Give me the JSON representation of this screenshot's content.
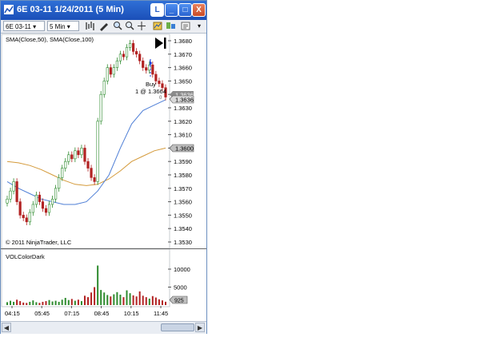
{
  "window": {
    "title": "6E 03-11  1/24/2011 (5 Min)",
    "btn_l": "L",
    "btn_min": "_",
    "btn_max": "□",
    "btn_close": "X"
  },
  "toolbar": {
    "instrument": "6E 03-11",
    "interval": "5 Min",
    "dropdown_glyph": "▾"
  },
  "price_panel": {
    "indicator_label": "SMA(Close,50), SMA(Close,100)",
    "copyright": "© 2011 NinjaTrader, LLC",
    "price_badge": "1.3636",
    "price_badge_top": "1.3636",
    "sma_badge": "1.3600",
    "order_text_1": "Buy",
    "order_text_2": "1 @ 1.3664",
    "order_small": "0"
  },
  "volume_panel": {
    "label": "VOLColorDark",
    "volume_badge": "925"
  },
  "colors": {
    "up": "#2e8b2e",
    "down": "#b22222",
    "sma50": "#4f7fd6",
    "sma100": "#d49a3a",
    "titlebar": "#2f6fd6"
  },
  "chart_data": [
    {
      "type": "line",
      "title": "",
      "x": [
        "04:15",
        "05:45",
        "07:15",
        "08:45",
        "10:15",
        "11:45"
      ],
      "ylim": [
        1.353,
        1.368
      ],
      "yticks": [
        "1.3680",
        "1.3670",
        "1.3660",
        "1.3650",
        "1.3640",
        "1.3630",
        "1.3620",
        "1.3610",
        "1.3600",
        "1.3590",
        "1.3580",
        "1.3570",
        "1.3560",
        "1.3550",
        "1.3540",
        "1.3530"
      ],
      "series": [
        {
          "values": [
            1.3562,
            1.3568,
            1.3575,
            1.356,
            1.355,
            1.3548,
            1.3545,
            1.3552,
            1.3558,
            1.3565,
            1.356,
            1.3555,
            1.3552,
            1.3558,
            1.3562,
            1.357,
            1.3578,
            1.3585,
            1.359,
            1.3595,
            1.3592,
            1.3598,
            1.3595,
            1.36,
            1.359,
            1.3585,
            1.3578,
            1.3575,
            1.362,
            1.364,
            1.365,
            1.366,
            1.3655,
            1.366,
            1.3665,
            1.367,
            1.3668,
            1.3675,
            1.3678,
            1.3672,
            1.367,
            1.3665,
            1.366,
            1.3658,
            1.3662,
            1.3655,
            1.365,
            1.3648,
            1.3645,
            1.3638
          ]
        },
        {
          "values": [
            1.3575,
            1.357,
            1.3566,
            1.3562,
            1.356,
            1.3558,
            1.3558,
            1.356,
            1.3568,
            1.358,
            1.36,
            1.3618,
            1.3628,
            1.3632,
            1.3636
          ]
        },
        {
          "values": [
            1.359,
            1.3589,
            1.3587,
            1.3584,
            1.358,
            1.3576,
            1.3573,
            1.3572,
            1.3573,
            1.3577,
            1.3583,
            1.359,
            1.3594,
            1.3598,
            1.36
          ]
        }
      ]
    },
    {
      "type": "bar",
      "title": "",
      "yticks": [
        "10000",
        "5000"
      ],
      "ylim": [
        0,
        12000
      ],
      "values": [
        800,
        1200,
        900,
        1500,
        1100,
        700,
        600,
        900,
        1300,
        800,
        600,
        900,
        1100,
        1400,
        1000,
        1200,
        900,
        1500,
        2000,
        1400,
        1700,
        1200,
        1500,
        1100,
        2600,
        2200,
        3500,
        5000,
        11000,
        4200,
        3500,
        2800,
        2400,
        3000,
        3600,
        2900,
        2200,
        4100,
        3300,
        2700,
        2400,
        3800,
        2600,
        2200,
        1800,
        2500,
        2100,
        1600,
        1300,
        925
      ]
    }
  ]
}
